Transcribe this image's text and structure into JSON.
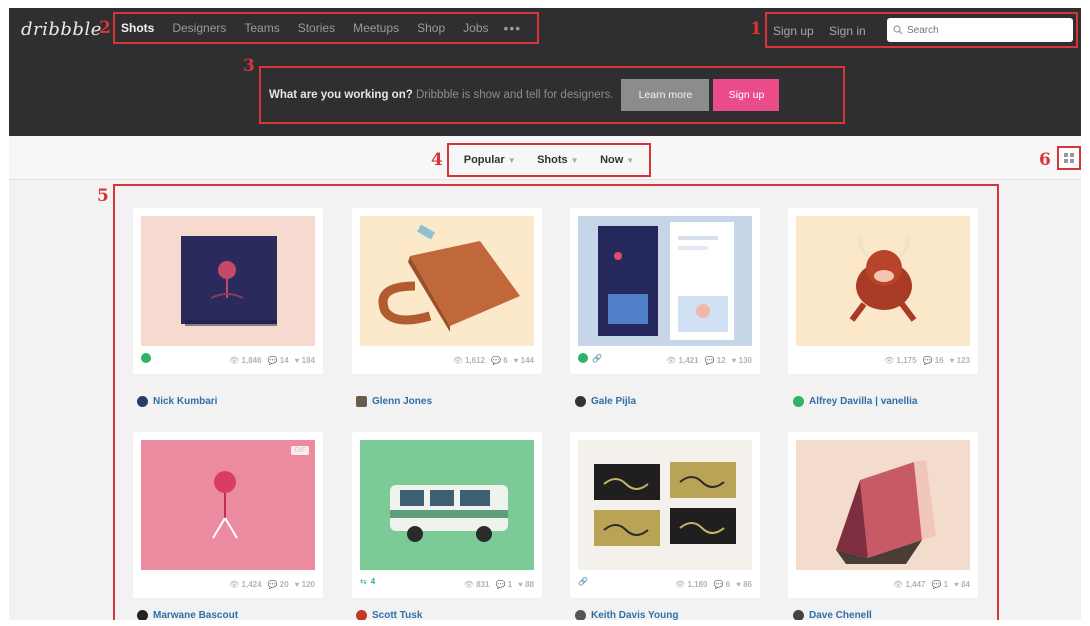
{
  "app": {
    "logo": "dribbble"
  },
  "nav": {
    "items": [
      "Shots",
      "Designers",
      "Teams",
      "Stories",
      "Meetups",
      "Shop",
      "Jobs"
    ],
    "more": "•••"
  },
  "auth": {
    "signup": "Sign up",
    "signin": "Sign in",
    "search_placeholder": "Search"
  },
  "hero": {
    "lead": "What are you working on?",
    "text": " Dribbble is show and tell for designers.",
    "learn_more": "Learn more",
    "signup": "Sign up"
  },
  "filters": {
    "sort": "Popular",
    "type": "Shots",
    "time": "Now"
  },
  "annotations": {
    "n1": "1",
    "n2": "2",
    "n3": "3",
    "n4": "4",
    "n5": "5",
    "n6": "6"
  },
  "shots": [
    {
      "author": "Nick Kumbari",
      "views": "1,846",
      "comments": "14",
      "likes": "184",
      "avatar_color": "#2a3a6b"
    },
    {
      "author": "Glenn Jones",
      "views": "1,612",
      "comments": "6",
      "likes": "144",
      "avatar_color": "#6b5a4a"
    },
    {
      "author": "Gale Pijla",
      "views": "1,421",
      "comments": "12",
      "likes": "130",
      "avatar_color": "#333333"
    },
    {
      "author": "Alfrey Davilla | vanellia",
      "views": "1,175",
      "comments": "16",
      "likes": "123",
      "avatar_color": "#2fb368"
    },
    {
      "author": "Marwane Bascout",
      "views": "1,424",
      "comments": "20",
      "likes": "120",
      "avatar_color": "#222222",
      "gif": "GIF"
    },
    {
      "author": "Scott Tusk",
      "views": "831",
      "comments": "1",
      "likes": "88",
      "avatar_color": "#c0392b",
      "rebound": "4"
    },
    {
      "author": "Keith Davis Young",
      "views": "1,180",
      "comments": "6",
      "likes": "86",
      "avatar_color": "#555555"
    },
    {
      "author": "Dave Chenell",
      "views": "1,447",
      "comments": "1",
      "likes": "84",
      "avatar_color": "#444444"
    }
  ],
  "colors": {
    "accent": "#ea4c89",
    "annotation": "#d8343c",
    "link": "#2e6fa8"
  }
}
